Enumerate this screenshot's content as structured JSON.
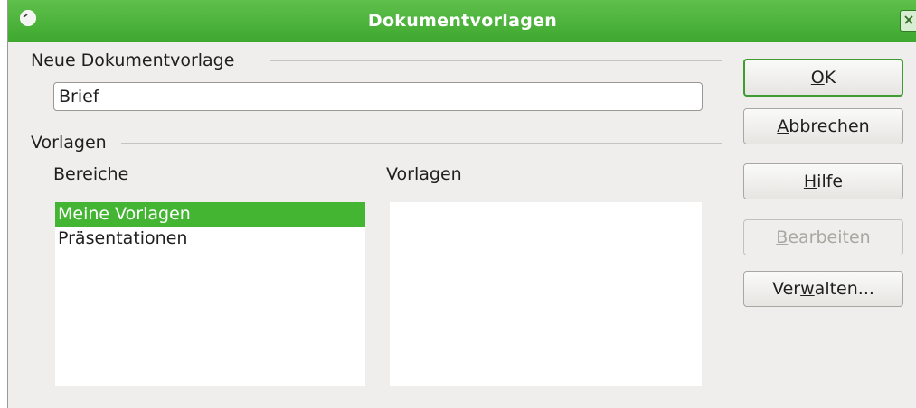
{
  "window": {
    "title": "Dokumentvorlagen",
    "menu_icon": "window-menu-icon",
    "close_icon": "close-icon"
  },
  "new_template": {
    "group_label": "Neue Dokumentvorlage",
    "name_value": "Brief"
  },
  "templates": {
    "group_label": "Vorlagen",
    "categories_label_mnemonic": "B",
    "categories_label_rest": "ereiche",
    "templates_label_mnemonic": "V",
    "templates_label_rest": "orlagen",
    "categories": [
      {
        "label": "Meine Vorlagen",
        "selected": true
      },
      {
        "label": "Präsentationen",
        "selected": false
      }
    ],
    "template_items": []
  },
  "buttons": {
    "ok": {
      "mnemonic": "O",
      "rest": "K"
    },
    "cancel": {
      "mnemonic": "A",
      "rest": "bbrechen"
    },
    "help": {
      "mnemonic": "H",
      "rest": "ilfe"
    },
    "edit": {
      "mnemonic": "B",
      "rest": "earbeiten"
    },
    "organize": {
      "before": "Ver",
      "mnemonic": "w",
      "rest": "alten..."
    }
  },
  "colors": {
    "titlebar": "#3ea82f",
    "selection": "#43b533",
    "dialog_bg": "#efeeec"
  }
}
